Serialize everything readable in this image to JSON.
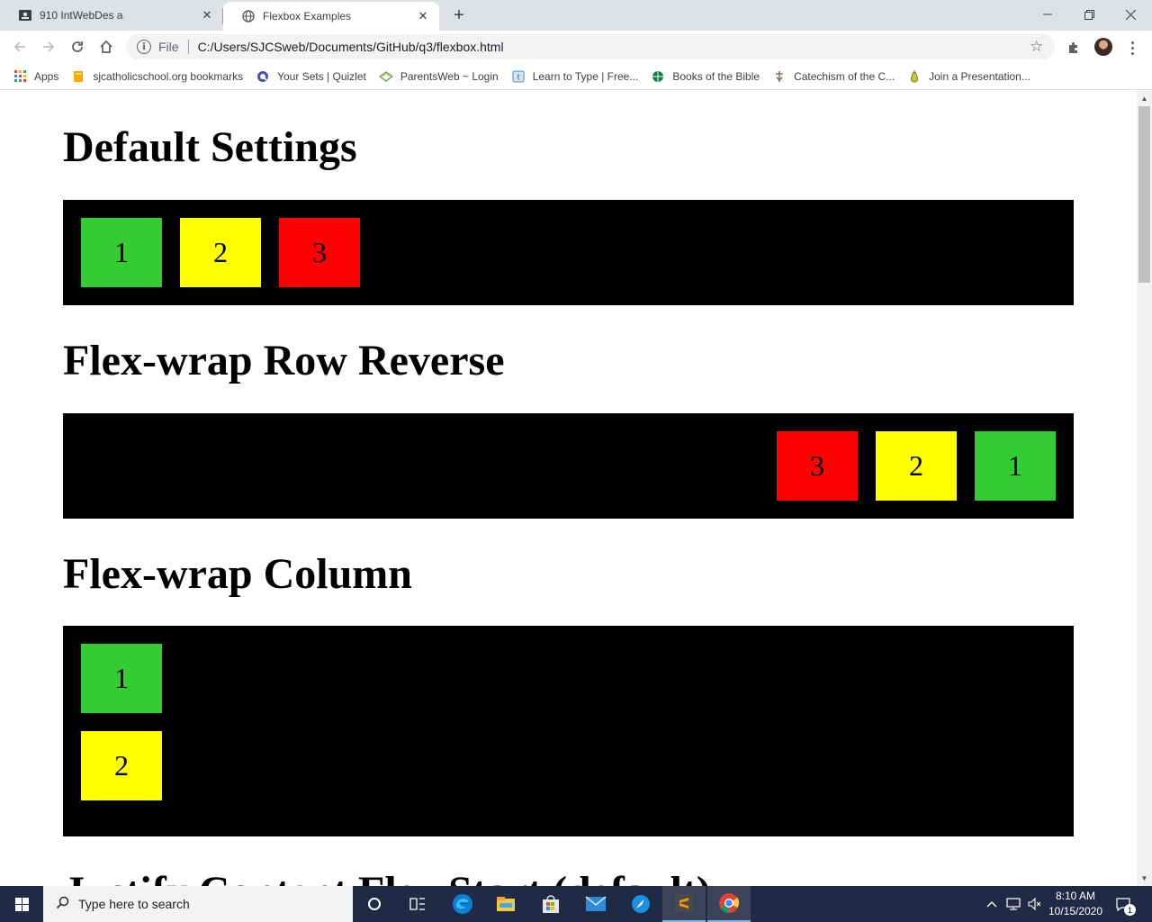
{
  "browser": {
    "tabs": [
      {
        "title": "910 IntWebDes a",
        "active": false,
        "icon": "classroom-icon"
      },
      {
        "title": "Flexbox Examples",
        "active": true,
        "icon": "globe-icon"
      }
    ],
    "address": {
      "scheme_label": "File",
      "url": "C:/Users/SJCSweb/Documents/GitHub/q3/flexbox.html"
    },
    "bookmarks": [
      {
        "label": "Apps",
        "icon": "apps-grid-icon"
      },
      {
        "label": "sjcatholicschool.org bookmarks",
        "icon": "folder-icon"
      },
      {
        "label": "Your Sets | Quizlet",
        "icon": "quizlet-icon"
      },
      {
        "label": "ParentsWeb ~ Login",
        "icon": "parentsweb-icon"
      },
      {
        "label": "Learn to Type | Free...",
        "icon": "typing-icon"
      },
      {
        "label": "Books of the Bible",
        "icon": "globe-green-icon"
      },
      {
        "label": "Catechism of the C...",
        "icon": "catechism-icon"
      },
      {
        "label": "Join a Presentation...",
        "icon": "pear-icon"
      }
    ]
  },
  "page": {
    "sections": [
      {
        "title": "Default Settings",
        "direction": "row",
        "items": [
          "1",
          "2",
          "3"
        ]
      },
      {
        "title": "Flex-wrap Row Reverse",
        "direction": "row-reverse",
        "items": [
          "1",
          "2",
          "3"
        ]
      },
      {
        "title": "Flex-wrap Column",
        "direction": "column",
        "items": [
          "1",
          "2"
        ]
      }
    ],
    "next_section_title": "Justify Content Flex Start (default)",
    "item_colors": [
      "#33cc33",
      "#ffff00",
      "#ff0000"
    ],
    "container_color": "#000000"
  },
  "taskbar": {
    "search_placeholder": "Type here to search",
    "time": "8:10 AM",
    "date": "10/15/2020",
    "notification_count": "1",
    "apps": [
      "task-view-icon",
      "edge-icon",
      "file-explorer-icon",
      "store-icon",
      "mail-icon",
      "safari-like-icon",
      "sublime-text-icon",
      "chrome-icon"
    ]
  }
}
